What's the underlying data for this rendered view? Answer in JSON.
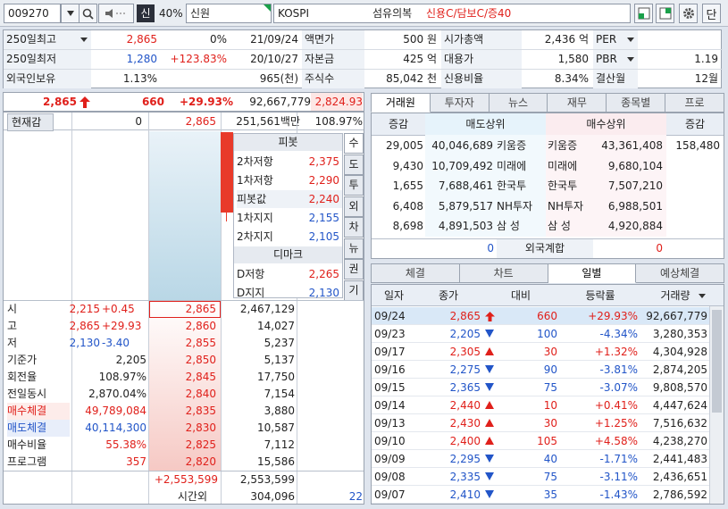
{
  "header": {
    "code": "009270",
    "credit_badge": "신",
    "rate": "40%",
    "name": "신원",
    "market": "KOSPI",
    "sector": "섬유의복",
    "flags": "신용C/담보C/증40",
    "end_button": "단"
  },
  "info": {
    "r1": {
      "l1": "250일최고",
      "v1": "2,865",
      "p1": "0%",
      "d1": "21/09/24",
      "l2": "액면가",
      "v2": "500 원",
      "l3": "시가총액",
      "v3": "2,436 억",
      "l4": "PER",
      "v4": ""
    },
    "r2": {
      "l1": "250일최저",
      "v1": "1,280",
      "p1": "+123.83%",
      "d1": "20/10/27",
      "l2": "자본금",
      "v2": "425 억",
      "l3": "대용가",
      "v3": "1,580",
      "l4": "PBR",
      "v4": "1.19"
    },
    "r3": {
      "l1": "외국인보유",
      "v1": "1.13%",
      "p1": "965(천)",
      "l2": "주식수",
      "v2": "85,042 천",
      "l3": "신용비율",
      "v3": "8.34%",
      "l4": "결산월",
      "v4": "12월"
    }
  },
  "price_line": {
    "price": "2,865",
    "change": "660",
    "rate": "+29.93%",
    "volume": "92,667,779",
    "prev": "2,824.93"
  },
  "ob_header": {
    "label": "현재감",
    "qty": "0",
    "price": "2,865",
    "amount": "251,561백만",
    "ratio": "108.97%"
  },
  "pivot": {
    "title": "피봇",
    "rows": [
      {
        "l": "2차저항",
        "v": "2,375"
      },
      {
        "l": "1차저항",
        "v": "2,290"
      },
      {
        "l": "피봇값",
        "v": "2,240"
      },
      {
        "l": "1차지지",
        "v": "2,155"
      },
      {
        "l": "2차지지",
        "v": "2,105"
      }
    ],
    "demark_title": "디마크",
    "demark": [
      {
        "l": "D저항",
        "v": "2,265"
      },
      {
        "l": "D지지",
        "v": "2,130"
      }
    ],
    "side_tabs": [
      "수",
      "도",
      "투",
      "외",
      "차",
      "뉴",
      "권",
      "기"
    ]
  },
  "left_stats": [
    {
      "l": "시",
      "v": "2,215",
      "x": "+0.45"
    },
    {
      "l": "고",
      "v": "2,865",
      "x": "+29.93"
    },
    {
      "l": "저",
      "v": "2,130",
      "x": "-3.40"
    },
    {
      "l": "기준가",
      "v": "2,205"
    },
    {
      "l": "회전율",
      "v": "108.97%"
    },
    {
      "l": "전일동시",
      "v": "2,870.04%"
    },
    {
      "l": "매수체결",
      "v": "49,789,084"
    },
    {
      "l": "매도체결",
      "v": "40,114,300"
    },
    {
      "l": "매수비율",
      "v": "55.38%"
    },
    {
      "l": "프로그램",
      "v": "357"
    }
  ],
  "bids": [
    {
      "p": "2,865",
      "q": "2,467,129"
    },
    {
      "p": "2,860",
      "q": "14,027"
    },
    {
      "p": "2,855",
      "q": "5,237"
    },
    {
      "p": "2,850",
      "q": "5,137"
    },
    {
      "p": "2,845",
      "q": "17,750"
    },
    {
      "p": "2,840",
      "q": "7,154"
    },
    {
      "p": "2,835",
      "q": "3,880"
    },
    {
      "p": "2,830",
      "q": "10,587"
    },
    {
      "p": "2,825",
      "q": "7,112"
    },
    {
      "p": "2,820",
      "q": "15,586"
    }
  ],
  "ob_footer": {
    "diff": "+2,553,599",
    "total": "2,553,599",
    "after_label": "시간외",
    "after_qty": "304,096",
    "after_extra": "22"
  },
  "right_tabs": [
    "거래원",
    "투자자",
    "뉴스",
    "재무",
    "종목별",
    "프로"
  ],
  "broker": {
    "headers": [
      "증감",
      "매도상위",
      "매수상위",
      "증감"
    ],
    "rows": [
      {
        "sc": "29,005",
        "sv": "40,046,689",
        "sn": "키움증",
        "bn": "키움증",
        "bv": "43,361,408",
        "bc": "158,480"
      },
      {
        "sc": "9,430",
        "sv": "10,709,492",
        "sn": "미래에",
        "bn": "미래에",
        "bv": "9,680,104",
        "bc": ""
      },
      {
        "sc": "1,655",
        "sv": "7,688,461",
        "sn": "한국투",
        "bn": "한국투",
        "bv": "7,507,210",
        "bc": ""
      },
      {
        "sc": "6,408",
        "sv": "5,879,517",
        "sn": "NH투자",
        "bn": "NH투자",
        "bv": "6,988,501",
        "bc": ""
      },
      {
        "sc": "8,698",
        "sv": "4,891,503",
        "sn": "삼 성",
        "bn": "삼 성",
        "bv": "4,920,884",
        "bc": ""
      }
    ],
    "foreign": {
      "left": "0",
      "label": "외국계합",
      "right": "0"
    }
  },
  "lower_tabs": [
    "체결",
    "차트",
    "일별",
    "예상체결"
  ],
  "daily": {
    "headers": [
      "일자",
      "종가",
      "대비",
      "등락률",
      "거래량"
    ],
    "rows": [
      {
        "d": "09/24",
        "c": "2,865",
        "dir": "up",
        "ch": "660",
        "r": "+29.93%",
        "v": "92,667,779"
      },
      {
        "d": "09/23",
        "c": "2,205",
        "dir": "down",
        "ch": "100",
        "r": "-4.34%",
        "v": "3,280,353"
      },
      {
        "d": "09/17",
        "c": "2,305",
        "dir": "up",
        "ch": "30",
        "r": "+1.32%",
        "v": "4,304,928"
      },
      {
        "d": "09/16",
        "c": "2,275",
        "dir": "down",
        "ch": "90",
        "r": "-3.81%",
        "v": "2,874,205"
      },
      {
        "d": "09/15",
        "c": "2,365",
        "dir": "down",
        "ch": "75",
        "r": "-3.07%",
        "v": "9,808,570"
      },
      {
        "d": "09/14",
        "c": "2,440",
        "dir": "up",
        "ch": "10",
        "r": "+0.41%",
        "v": "4,447,624"
      },
      {
        "d": "09/13",
        "c": "2,430",
        "dir": "up",
        "ch": "30",
        "r": "+1.25%",
        "v": "7,516,632"
      },
      {
        "d": "09/10",
        "c": "2,400",
        "dir": "up",
        "ch": "105",
        "r": "+4.58%",
        "v": "4,238,270"
      },
      {
        "d": "09/09",
        "c": "2,295",
        "dir": "down",
        "ch": "40",
        "r": "-1.71%",
        "v": "2,441,483"
      },
      {
        "d": "09/08",
        "c": "2,335",
        "dir": "down",
        "ch": "75",
        "r": "-3.11%",
        "v": "2,436,651"
      },
      {
        "d": "09/07",
        "c": "2,410",
        "dir": "down",
        "ch": "35",
        "r": "-1.43%",
        "v": "2,786,592"
      }
    ]
  },
  "colors": {
    "up": "#e0201b",
    "down": "#2255c8",
    "bar": "#e83a2a"
  }
}
